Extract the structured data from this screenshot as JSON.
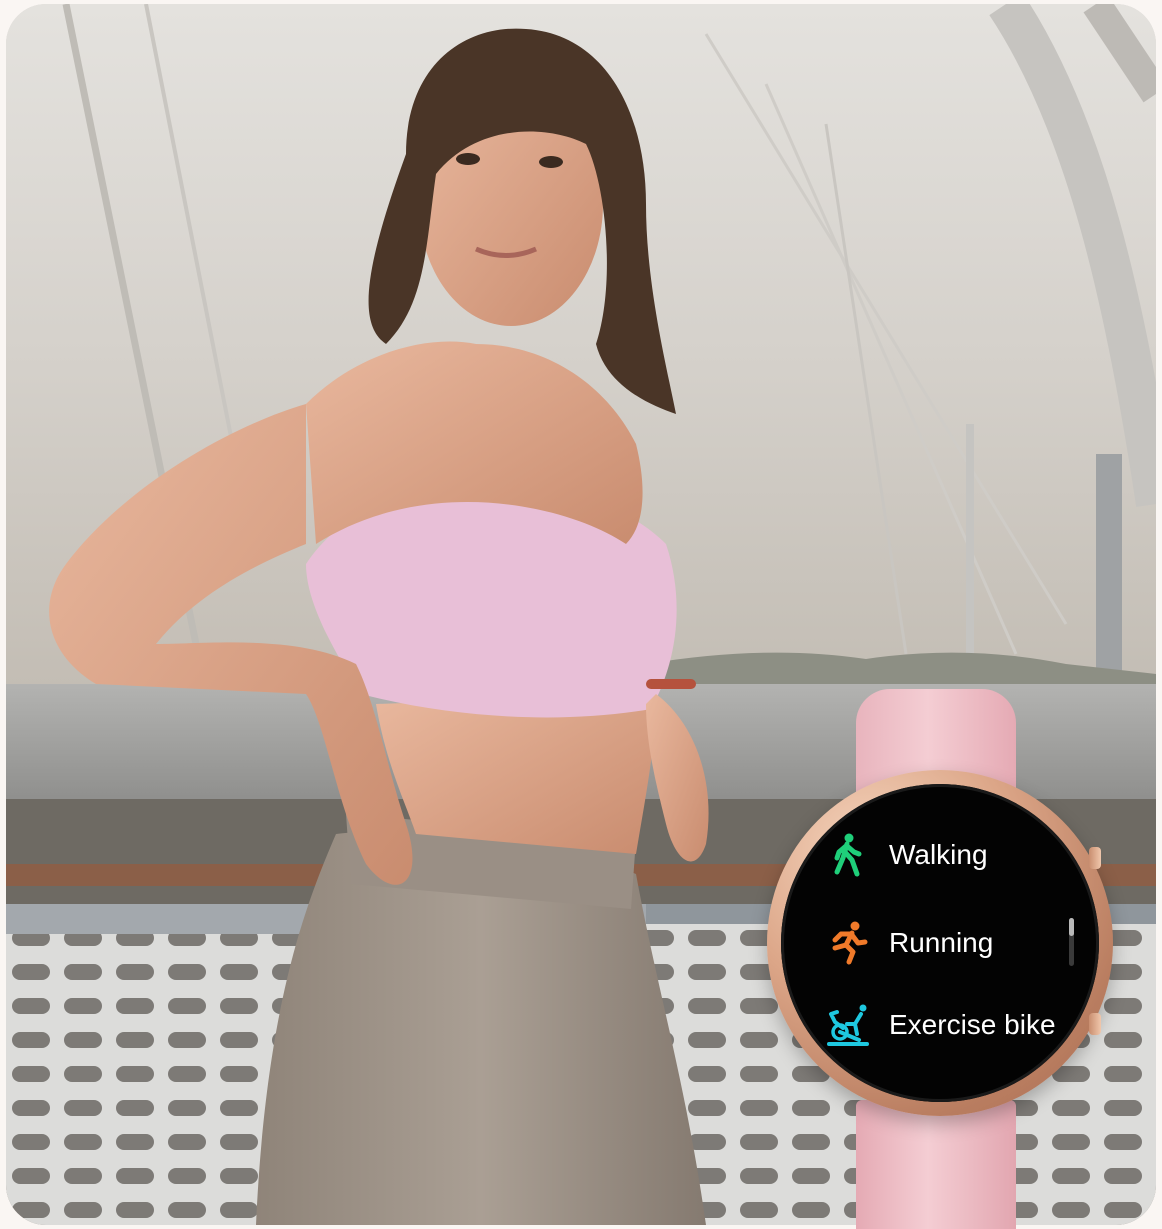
{
  "watch": {
    "menu": [
      {
        "label": "Walking",
        "icon": "walking-icon",
        "color": "#1fcf7a"
      },
      {
        "label": "Running",
        "icon": "running-icon",
        "color": "#f07a2a"
      },
      {
        "label": "Exercise bike",
        "icon": "exercise-bike-icon",
        "color": "#1ec8e0"
      }
    ],
    "strap_color": "#f2c6cd",
    "case_color": "#d9a080"
  }
}
